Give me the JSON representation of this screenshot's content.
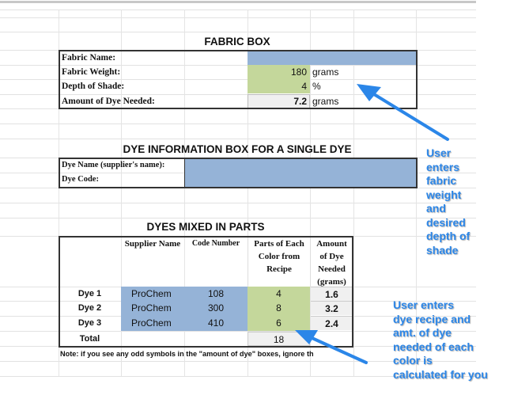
{
  "fabric_box": {
    "title": "FABRIC BOX",
    "rows": [
      {
        "label": "Fabric Name:",
        "value": "",
        "unit": ""
      },
      {
        "label": "Fabric Weight:",
        "value": "180",
        "unit": "grams"
      },
      {
        "label": "Depth of Shade:",
        "value": "4",
        "unit": "%"
      },
      {
        "label": "Amount of Dye Needed:",
        "value": "7.2",
        "unit": "grams"
      }
    ]
  },
  "dye_info_box": {
    "title": "DYE INFORMATION BOX FOR A SINGLE DYE",
    "rows": [
      {
        "label": "Dye Name (supplier's name):",
        "value": ""
      },
      {
        "label": "Dye Code:",
        "value": ""
      }
    ]
  },
  "dyes_mixed": {
    "title": "DYES MIXED IN PARTS",
    "headers": [
      "",
      "Supplier Name",
      "Code Number",
      "Parts of Each Color from Recipe",
      "Amount of Dye Needed (grams)"
    ],
    "rows": [
      {
        "label": "Dye 1",
        "supplier": "ProChem",
        "code": "108",
        "parts": "4",
        "amount": "1.6"
      },
      {
        "label": "Dye 2",
        "supplier": "ProChem",
        "code": "300",
        "parts": "8",
        "amount": "3.2"
      },
      {
        "label": "Dye 3",
        "supplier": "ProChem",
        "code": "410",
        "parts": "6",
        "amount": "2.4"
      }
    ],
    "total": {
      "label": "Total",
      "parts": "18"
    },
    "note": "Note: if you see any odd symbols in the \"amount of dye\" boxes, ignore these."
  },
  "annotations": {
    "fabric": "User enters fabric weight and desired depth of shade",
    "fabric_lines": [
      "User",
      "enters",
      "fabric",
      "weight",
      "and",
      "desired",
      "depth of",
      "shade"
    ],
    "recipe": "User enters dye recipe and amt. of dye needed of each color is calculated for you",
    "recipe_lines": [
      "User enters",
      "dye recipe and",
      "amt. of dye",
      "needed of each",
      "color is",
      "calculated for you"
    ]
  },
  "colors": {
    "input_blue": "#95b3d7",
    "input_green": "#c4d79b",
    "calc_gray": "#f0f0f0",
    "annotation_blue": "#2b86e8"
  }
}
